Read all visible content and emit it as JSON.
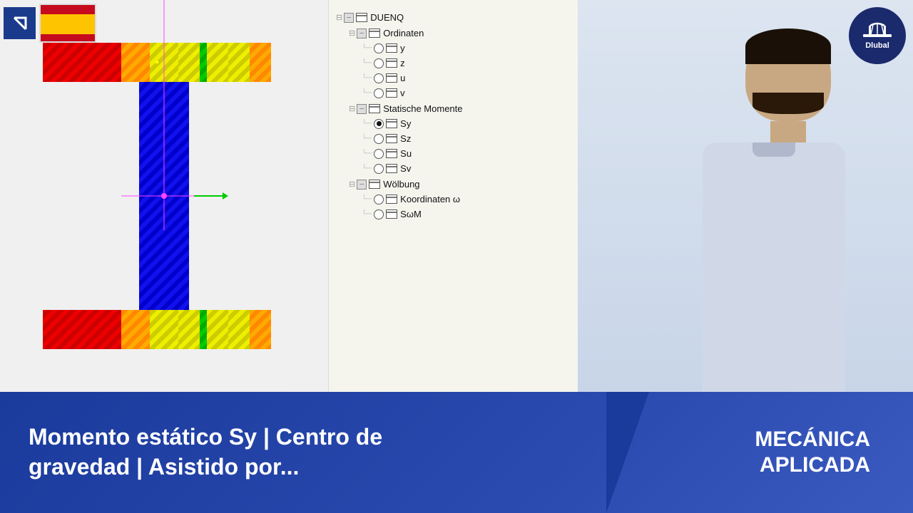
{
  "topLeft": {
    "arrowLabel": "↘",
    "flagAlt": "Spain flag"
  },
  "treePanel": {
    "title": "DUENQ",
    "items": [
      {
        "label": "DUENQ",
        "level": 0,
        "type": "parent",
        "hasExpand": true,
        "hasCheckbox": true,
        "hasWindow": true
      },
      {
        "label": "Ordinaten",
        "level": 1,
        "type": "parent",
        "hasExpand": true,
        "hasCheckbox": true,
        "hasWindow": true
      },
      {
        "label": "y",
        "level": 2,
        "type": "radio",
        "selected": false
      },
      {
        "label": "z",
        "level": 2,
        "type": "radio",
        "selected": false
      },
      {
        "label": "u",
        "level": 2,
        "type": "radio",
        "selected": false
      },
      {
        "label": "v",
        "level": 2,
        "type": "radio",
        "selected": false
      },
      {
        "label": "Statische Momente",
        "level": 1,
        "type": "parent",
        "hasExpand": true,
        "hasCheckbox": true,
        "hasWindow": true
      },
      {
        "label": "Sy",
        "level": 2,
        "type": "radio",
        "selected": true
      },
      {
        "label": "Sz",
        "level": 2,
        "type": "radio",
        "selected": false
      },
      {
        "label": "Su",
        "level": 2,
        "type": "radio",
        "selected": false
      },
      {
        "label": "Sv",
        "level": 2,
        "type": "radio",
        "selected": false
      },
      {
        "label": "Wölbung",
        "level": 1,
        "type": "parent",
        "hasExpand": true,
        "hasCheckbox": true,
        "hasWindow": true
      },
      {
        "label": "Koordinaten ω",
        "level": 2,
        "type": "radio",
        "selected": false
      },
      {
        "label": "SωM",
        "level": 2,
        "type": "radio",
        "selected": false
      }
    ]
  },
  "dlubalLogo": {
    "text": "Dlubal"
  },
  "bottomBar": {
    "title": "Momento estático Sy | Centro de gravedad | Asistido por...",
    "category1": "MECÁNICA",
    "category2": "APLICADA"
  },
  "colors": {
    "darkBlue": "#1a3a9c",
    "logoBlue": "#1a2a6c"
  }
}
